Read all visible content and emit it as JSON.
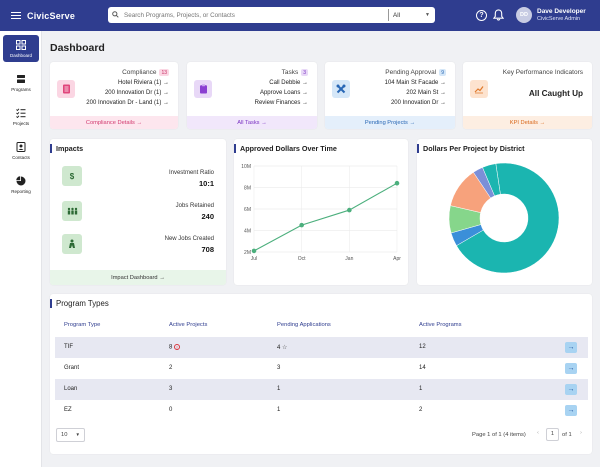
{
  "app": {
    "name": "CivicServe"
  },
  "search": {
    "placeholder": "Search Programs, Projects, or Contacts",
    "scope": "All"
  },
  "user": {
    "initials": "DD",
    "name": "Dave Developer",
    "role": "CivicServe Admin"
  },
  "sidebar": {
    "items": [
      {
        "label": "Dashboard",
        "icon": "grid-icon"
      },
      {
        "label": "Programs",
        "icon": "stack-icon"
      },
      {
        "label": "Projects",
        "icon": "checklist-icon"
      },
      {
        "label": "Contacts",
        "icon": "contacts-icon"
      },
      {
        "label": "Reporting",
        "icon": "pie-chart-icon"
      }
    ]
  },
  "page": {
    "title": "Dashboard"
  },
  "cards": {
    "compliance": {
      "title": "Compliance",
      "count": "13",
      "rows": [
        "Hotel Riviera (1)",
        "200 Innovation Dr (1)",
        "200 Innovation Dr - Land (1)"
      ],
      "footer": "Compliance Details",
      "icon": "document-icon"
    },
    "tasks": {
      "title": "Tasks",
      "count": "3",
      "rows": [
        "Call Debbie",
        "Approve Loans",
        "Review Finances"
      ],
      "footer": "All Tasks",
      "icon": "clipboard-icon"
    },
    "pending": {
      "title": "Pending Approval",
      "count": "9",
      "rows": [
        "104 Main St Facade",
        "202 Main St",
        "200 Innovation Dr"
      ],
      "footer": "Pending Projects",
      "icon": "tools-icon"
    },
    "kpi": {
      "title": "Key Performance Indicators",
      "status": "All Caught Up",
      "footer": "KPI Details",
      "icon": "trend-icon"
    }
  },
  "impacts": {
    "title": "Impacts",
    "items": [
      {
        "label": "Investment Ratio",
        "value": "10:1",
        "icon": "dollar-icon"
      },
      {
        "label": "Jobs Retained",
        "value": "240",
        "icon": "people-icon"
      },
      {
        "label": "New Jobs Created",
        "value": "708",
        "icon": "worker-icon"
      }
    ],
    "footer": "Impact Dashboard"
  },
  "line_chart_title": "Approved Dollars Over Time",
  "donut_chart_title": "Dollars Per Project by District",
  "chart_data": [
    {
      "type": "line",
      "title": "Approved Dollars Over Time",
      "x": [
        "Jul",
        "Oct",
        "Jan",
        "Apr"
      ],
      "y_ticks": [
        "2M",
        "4M",
        "6M",
        "8M",
        "10M"
      ],
      "ylim": [
        2,
        10
      ],
      "series": [
        {
          "values": [
            2.1,
            4.5,
            5.9,
            8.4
          ],
          "color": "#4caf7d"
        }
      ],
      "grid": true
    },
    {
      "type": "pie",
      "title": "Dollars Per Project by District",
      "donut": true,
      "values": [
        69,
        4,
        8,
        12,
        3,
        4
      ],
      "colors": [
        "#1bb5b0",
        "#3b8fd9",
        "#86d68b",
        "#f7a27c",
        "#7b8fd8",
        "#1bb5b0"
      ]
    }
  ],
  "program_types": {
    "title": "Program Types",
    "columns": [
      "Program Type",
      "Active Projects",
      "Pending Applications",
      "Active Programs"
    ],
    "rows": [
      {
        "type": "TIF",
        "active_projects": "8",
        "pending": "4",
        "programs": "12",
        "flag_projects": "alert-icon",
        "flag_pending": "star-icon"
      },
      {
        "type": "Grant",
        "active_projects": "2",
        "pending": "3",
        "programs": "14"
      },
      {
        "type": "Loan",
        "active_projects": "3",
        "pending": "1",
        "programs": "1"
      },
      {
        "type": "EZ",
        "active_projects": "0",
        "pending": "1",
        "programs": "2"
      }
    ],
    "page_size": "10",
    "page_info": "Page 1 of 1 (4 items)",
    "current_page": "1",
    "of_pages": "of 1"
  }
}
